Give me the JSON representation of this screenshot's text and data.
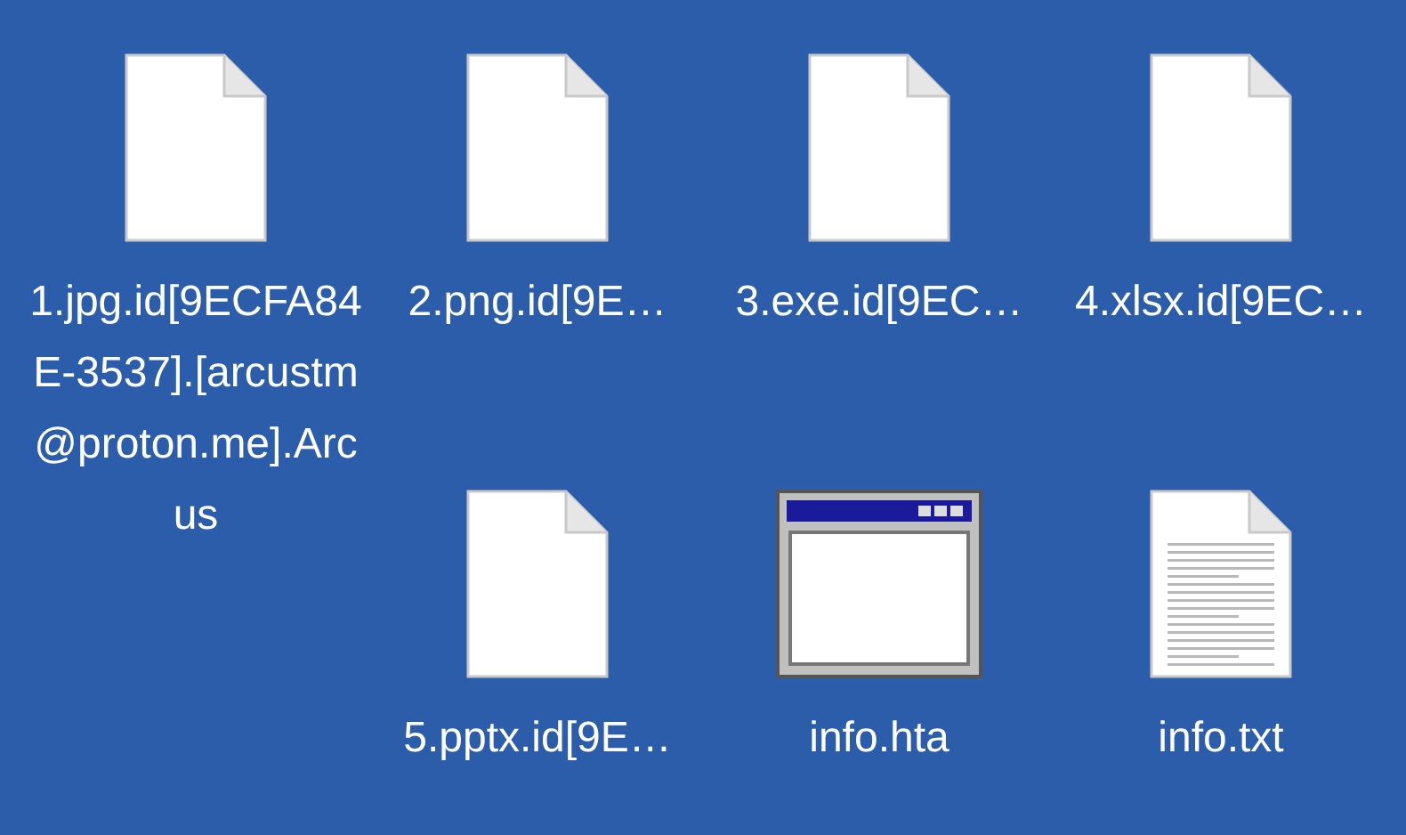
{
  "files": [
    {
      "kind": "blank",
      "name": "1.jpg.id[9ECFA84E-3537].[arcustm@proton.me].Arcus"
    },
    {
      "kind": "blank",
      "name": "2.png.id[9E…"
    },
    {
      "kind": "blank",
      "name": "3.exe.id[9EC…"
    },
    {
      "kind": "blank",
      "name": "4.xlsx.id[9EC…"
    },
    {
      "kind": "blank",
      "name": "5.pptx.id[9E…"
    },
    {
      "kind": "window",
      "name": "info.hta"
    },
    {
      "kind": "text",
      "name": "info.txt"
    }
  ]
}
